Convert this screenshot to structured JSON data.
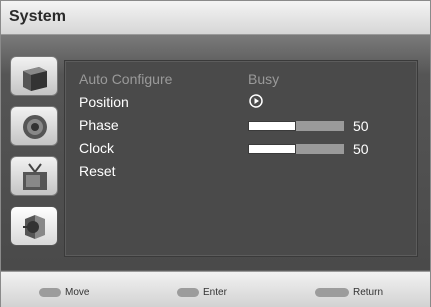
{
  "window": {
    "title": "System"
  },
  "menu": {
    "items": [
      {
        "label": "Auto Configure",
        "value": "Busy",
        "disabled": true
      },
      {
        "label": "Position",
        "value_icon": "play-circle-icon"
      },
      {
        "label": "Phase",
        "value": "50",
        "level": 0.5
      },
      {
        "label": "Clock",
        "value": "50",
        "level": 0.5
      },
      {
        "label": "Reset"
      }
    ]
  },
  "sidebar": {
    "icons": [
      "picture-icon",
      "sound-icon",
      "tv-antenna-icon",
      "system-icon"
    ],
    "selected": "system-icon"
  },
  "footer": {
    "move_label": "Move",
    "enter_label": "Enter",
    "return_label": "Return"
  },
  "colors": {
    "panel": "#4a4a4a",
    "text": "#ffffff",
    "dim_text": "#9a9a9a",
    "bar_track": "#9a9a9a"
  }
}
